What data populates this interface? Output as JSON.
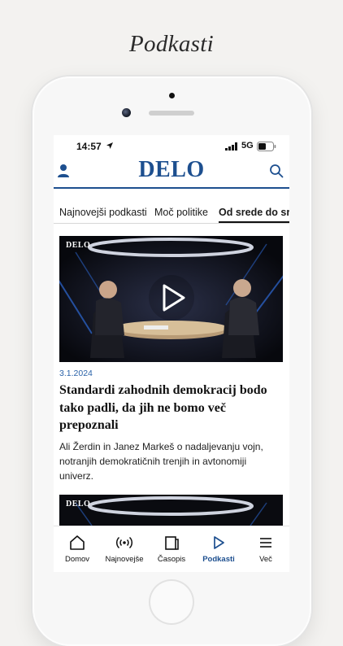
{
  "promo": {
    "title": "Podkasti"
  },
  "status": {
    "time": "14:57",
    "network": "5G"
  },
  "header": {
    "logo": "DELO"
  },
  "tabs": [
    {
      "label": "Najnovejši podkasti",
      "active": false
    },
    {
      "label": "Moč politike",
      "active": false
    },
    {
      "label": "Od srede do sred",
      "active": true
    }
  ],
  "articles": [
    {
      "image_tag": "DELO",
      "date": "3.1.2024",
      "headline": "Standardi zahodnih demokracij bodo tako padli, da jih ne bomo več prepoznali",
      "summary": "Ali Žerdin in Janez Markeš o nadaljevanju vojn, notranjih demokratičnih trenjih in avtonomiji univerz."
    },
    {
      "image_tag": "DELO"
    }
  ],
  "nav": [
    {
      "label": "Domov",
      "icon": "home-icon"
    },
    {
      "label": "Najnovejše",
      "icon": "broadcast-icon"
    },
    {
      "label": "Časopis",
      "icon": "newspaper-icon"
    },
    {
      "label": "Podkasti",
      "icon": "play-icon",
      "active": true
    },
    {
      "label": "Več",
      "icon": "menu-icon"
    }
  ],
  "colors": {
    "brand": "#1d4f8f",
    "date": "#2a62a8",
    "background": "#f3f2f0"
  }
}
